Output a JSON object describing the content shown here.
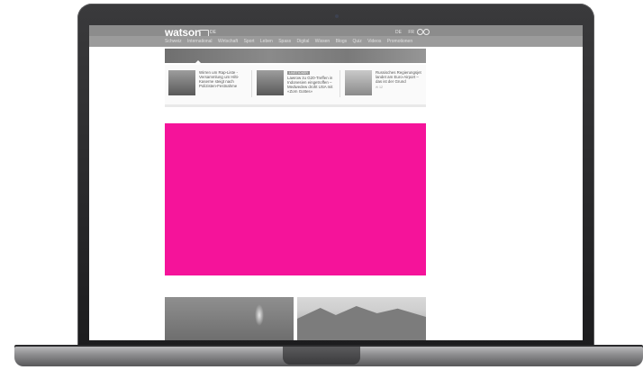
{
  "site": {
    "logo": "watson",
    "lang_small": "DE",
    "right_links": [
      "DE",
      "FR"
    ]
  },
  "nav": {
    "items": [
      "Schweiz",
      "International",
      "Wirtschaft",
      "Sport",
      "Leben",
      "Spass",
      "Digital",
      "Wissen",
      "Blogs",
      "Quiz",
      "Videos",
      "Promotionen"
    ]
  },
  "teasers": [
    {
      "title": "Wirren um Rap-Liste - Versammlung um Hilti-Kaserne steigt nach Polizisten-Festnahme",
      "tag": "",
      "meta": ""
    },
    {
      "title": "Lawrow zu G20-Treffen in Indonesien eingetroffen – Medwedew droht USA mit «Zorn Gottes»",
      "tag": "LIVETICKER",
      "meta": ""
    },
    {
      "title": "Russisches Regierungsjet landet am Euro-Airport – das ist der Grund",
      "tag": "",
      "meta": "✉ 12"
    }
  ],
  "colors": {
    "ad_block": "#f5139a",
    "header_bg": "#8c8c8c"
  }
}
